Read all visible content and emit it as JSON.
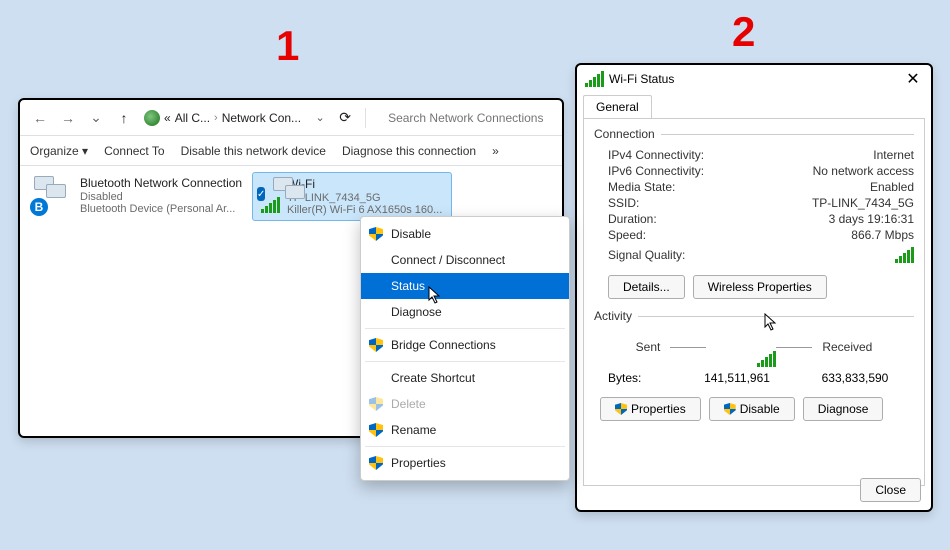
{
  "annotations": {
    "one": "1",
    "two": "2"
  },
  "win1": {
    "breadcrumb": {
      "seg1": "All C...",
      "seg2": "Network Con..."
    },
    "search_placeholder": "Search Network Connections",
    "toolbar": {
      "organize": "Organize",
      "connect": "Connect To",
      "disable": "Disable this network device",
      "diagnose": "Diagnose this connection",
      "overflow": "»"
    },
    "conn_bt": {
      "title": "Bluetooth Network Connection",
      "status": "Disabled",
      "device": "Bluetooth Device (Personal Ar..."
    },
    "conn_wifi": {
      "title": "Wi-Fi",
      "ssid": "TP-LINK_7434_5G",
      "device": "Killer(R) Wi-Fi 6 AX1650s 160..."
    },
    "context_menu": {
      "disable": "Disable",
      "connect": "Connect / Disconnect",
      "status": "Status",
      "diagnose": "Diagnose",
      "bridge": "Bridge Connections",
      "shortcut": "Create Shortcut",
      "delete": "Delete",
      "rename": "Rename",
      "properties": "Properties"
    }
  },
  "win2": {
    "title": "Wi-Fi Status",
    "tab": "General",
    "group_conn": "Connection",
    "rows": {
      "ipv4k": "IPv4 Connectivity:",
      "ipv4v": "Internet",
      "ipv6k": "IPv6 Connectivity:",
      "ipv6v": "No network access",
      "mediak": "Media State:",
      "mediav": "Enabled",
      "ssidk": "SSID:",
      "ssidv": "TP-LINK_7434_5G",
      "durk": "Duration:",
      "durv": "3 days 19:16:31",
      "spdk": "Speed:",
      "spdv": "866.7 Mbps",
      "sigk": "Signal Quality:"
    },
    "buttons": {
      "details": "Details...",
      "wireless": "Wireless Properties"
    },
    "group_act": "Activity",
    "activity": {
      "sent": "Sent",
      "received": "Received",
      "bytes_label": "Bytes:",
      "bytes_sent": "141,511,961",
      "bytes_recv": "633,833,590"
    },
    "bottoms": {
      "properties": "Properties",
      "disable": "Disable",
      "diagnose": "Diagnose"
    },
    "close": "Close"
  }
}
